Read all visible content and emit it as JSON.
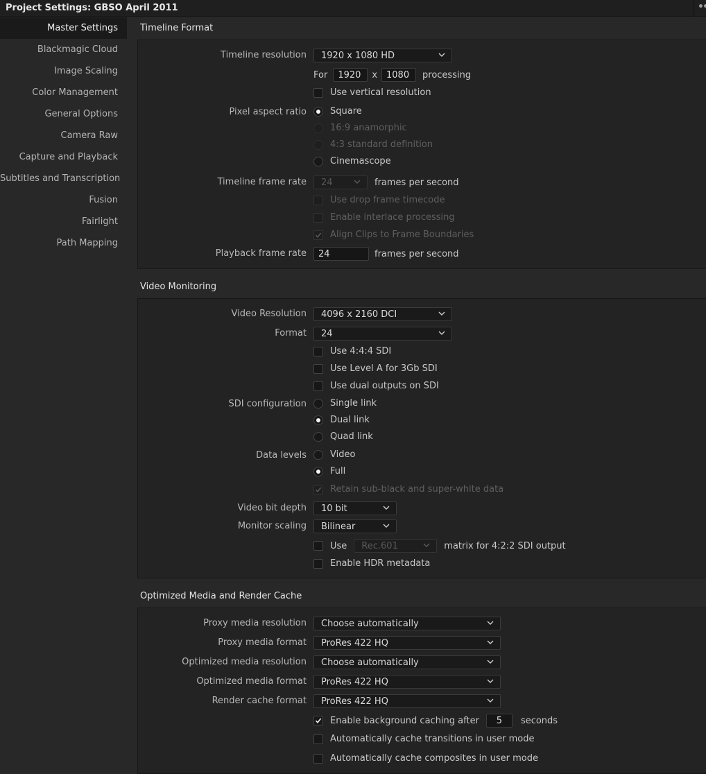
{
  "window": {
    "title": "Project Settings:  GBSO April 2011"
  },
  "sidebar": {
    "items": [
      {
        "label": "Master Settings"
      },
      {
        "label": "Blackmagic Cloud"
      },
      {
        "label": "Image Scaling"
      },
      {
        "label": "Color Management"
      },
      {
        "label": "General Options"
      },
      {
        "label": "Camera Raw"
      },
      {
        "label": "Capture and Playback"
      },
      {
        "label": "Subtitles and Transcription"
      },
      {
        "label": "Fusion"
      },
      {
        "label": "Fairlight"
      },
      {
        "label": "Path Mapping"
      }
    ]
  },
  "timeline_format": {
    "title": "Timeline Format",
    "resolution_label": "Timeline resolution",
    "resolution_value": "1920 x 1080 HD",
    "for_label": "For",
    "width_value": "1920",
    "x_label": "x",
    "height_value": "1080",
    "processing_label": "processing",
    "use_vertical_label": "Use vertical resolution",
    "pixel_aspect_label": "Pixel aspect ratio",
    "aspect_square": "Square",
    "aspect_anamorphic": "16:9 anamorphic",
    "aspect_standard": "4:3 standard definition",
    "aspect_cinemascope": "Cinemascope",
    "frame_rate_label": "Timeline frame rate",
    "frame_rate_value": "24",
    "fps_label": "frames per second",
    "drop_frame_label": "Use drop frame timecode",
    "interlace_label": "Enable interlace processing",
    "align_clips_label": "Align Clips to Frame Boundaries",
    "playback_rate_label": "Playback frame rate",
    "playback_rate_value": "24",
    "playback_fps_label": "frames per second"
  },
  "video_monitoring": {
    "title": "Video Monitoring",
    "resolution_label": "Video Resolution",
    "resolution_value": "4096 x 2160 DCI",
    "format_label": "Format",
    "format_value": "24",
    "use_444_label": "Use 4:4:4 SDI",
    "use_level_a_label": "Use Level A for 3Gb SDI",
    "use_dual_outputs_label": "Use dual outputs on SDI",
    "sdi_config_label": "SDI configuration",
    "sdi_single": "Single link",
    "sdi_dual": "Dual link",
    "sdi_quad": "Quad link",
    "data_levels_label": "Data levels",
    "levels_video": "Video",
    "levels_full": "Full",
    "retain_label": "Retain sub-black and super-white data",
    "bit_depth_label": "Video bit depth",
    "bit_depth_value": "10 bit",
    "monitor_scaling_label": "Monitor scaling",
    "monitor_scaling_value": "Bilinear",
    "use_label": "Use",
    "matrix_value": "Rec.601",
    "matrix_suffix": "matrix for 4:2:2 SDI output",
    "hdr_label": "Enable HDR metadata"
  },
  "optimized_media": {
    "title": "Optimized Media and Render Cache",
    "proxy_res_label": "Proxy media resolution",
    "proxy_res_value": "Choose automatically",
    "proxy_format_label": "Proxy media format",
    "proxy_format_value": "ProRes 422 HQ",
    "opt_res_label": "Optimized media resolution",
    "opt_res_value": "Choose automatically",
    "opt_format_label": "Optimized media format",
    "opt_format_value": "ProRes 422 HQ",
    "render_cache_label": "Render cache format",
    "render_cache_value": "ProRes 422 HQ",
    "bg_caching_label": "Enable background caching after",
    "bg_caching_value": "5",
    "seconds_label": "seconds",
    "cache_transitions_label": "Automatically cache transitions in user mode",
    "cache_composites_label": "Automatically cache composites in user mode"
  }
}
